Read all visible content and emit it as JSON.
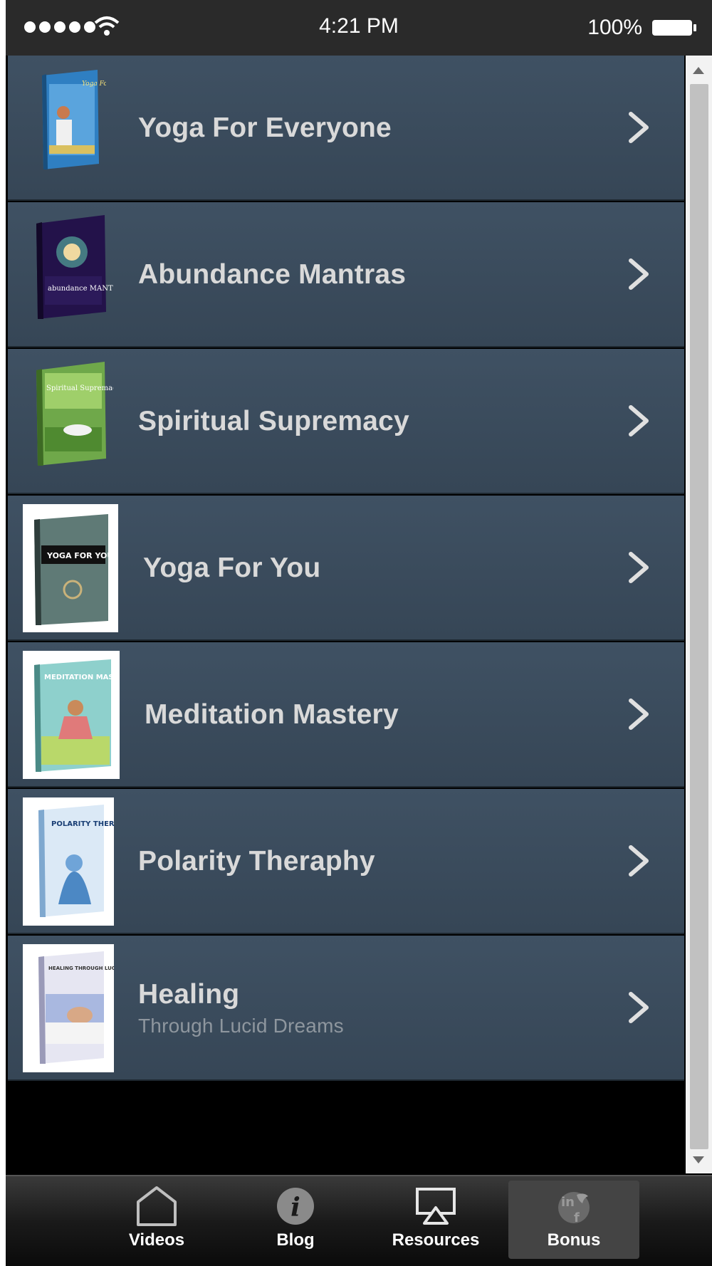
{
  "status_bar": {
    "time": "4:21 PM",
    "battery": "100%"
  },
  "list": {
    "items": [
      {
        "title": "Yoga For Everyone",
        "subtitle": "",
        "cover": "Yoga For Everyone"
      },
      {
        "title": "Abundance Mantras",
        "subtitle": "",
        "cover": "abundance MANTRAS"
      },
      {
        "title": "Spiritual  Supremacy",
        "subtitle": "",
        "cover": "Spiritual Supremacy"
      },
      {
        "title": "Yoga For You",
        "subtitle": "",
        "cover": "YOGA FOR YOU"
      },
      {
        "title": "Meditation Mastery",
        "subtitle": "",
        "cover": "MEDITATION MASTERY"
      },
      {
        "title": "Polarity  Theraphy",
        "subtitle": "",
        "cover": "POLARITY THERAPY"
      },
      {
        "title": "Healing",
        "subtitle": "Through Lucid Dreams",
        "cover": "HEALING THROUGH LUCID DREAMS"
      }
    ]
  },
  "tab_bar": {
    "tabs": [
      {
        "label": "Videos",
        "icon": "home-icon"
      },
      {
        "label": "Blog",
        "icon": "info-icon"
      },
      {
        "label": "Resources",
        "icon": "airplay-icon"
      },
      {
        "label": "Bonus",
        "icon": "social-icon",
        "active": true
      }
    ]
  },
  "colors": {
    "row_bg": "#3f5163",
    "title_text": "#d9d9d9",
    "subtitle_text": "#8e969e",
    "status_bar": "#2a2a2a"
  }
}
